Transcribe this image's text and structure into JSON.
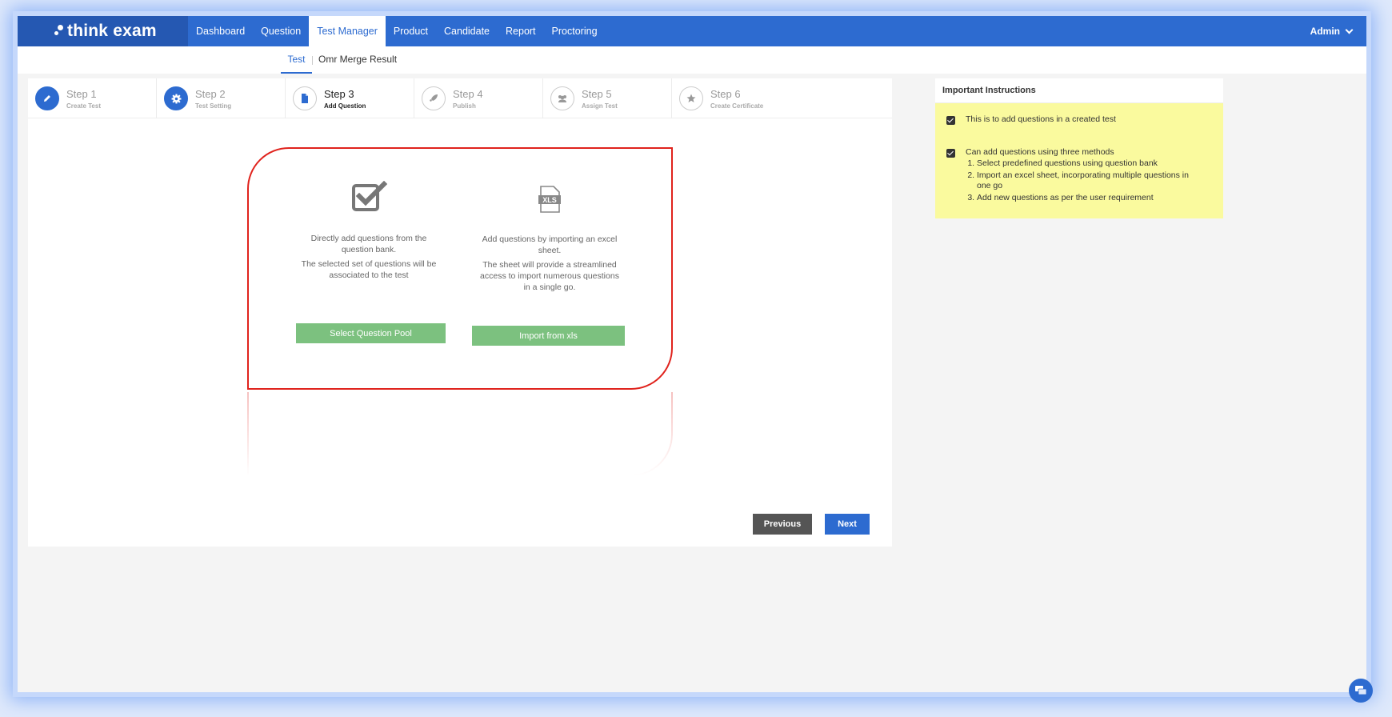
{
  "brand": "think exam",
  "nav": {
    "items": [
      "Dashboard",
      "Question",
      "Test Manager",
      "Product",
      "Candidate",
      "Report",
      "Proctoring"
    ],
    "active": "Test Manager",
    "user": "Admin"
  },
  "subnav": {
    "test": "Test",
    "omr": "Omr Merge Result"
  },
  "steps": [
    {
      "title": "Step 1",
      "sub": "Create Test",
      "icon": "pencil-icon",
      "state": "done"
    },
    {
      "title": "Step 2",
      "sub": "Test Setting",
      "icon": "gear-icon",
      "state": "done"
    },
    {
      "title": "Step 3",
      "sub": "Add Question",
      "icon": "file-icon",
      "state": "current"
    },
    {
      "title": "Step 4",
      "sub": "Publish",
      "icon": "rocket-icon",
      "state": "pending"
    },
    {
      "title": "Step 5",
      "sub": "Assign Test",
      "icon": "users-icon",
      "state": "pending"
    },
    {
      "title": "Step 6",
      "sub": "Create Certificate",
      "icon": "star-icon",
      "state": "pending"
    }
  ],
  "options": {
    "pool": {
      "line1": "Directly add questions from the question bank.",
      "line2": "The selected set of questions will be associated to the test",
      "button": "Select Question Pool",
      "icon": "checkbox-icon"
    },
    "xls": {
      "line1": "Add questions by importing an excel sheet.",
      "line2": "The sheet will provide a streamlined access to import numerous questions in a single go.",
      "button": "Import from xls",
      "icon": "xls-file-icon",
      "icon_text": "XLS"
    }
  },
  "buttons": {
    "previous": "Previous",
    "next": "Next"
  },
  "instructions": {
    "title": "Important Instructions",
    "item1": "This is to add questions in a created test",
    "item2": "Can add questions using three methods",
    "methods": [
      "Select predefined questions using question bank",
      "Import an excel sheet, incorporating multiple questions in one go",
      "Add new questions as per the user requirement"
    ]
  },
  "colors": {
    "primary": "#2d6bd0",
    "brand_dark": "#2558b2",
    "green": "#7cc17f",
    "highlight": "#e0231d",
    "note_bg": "#fafa9e"
  }
}
